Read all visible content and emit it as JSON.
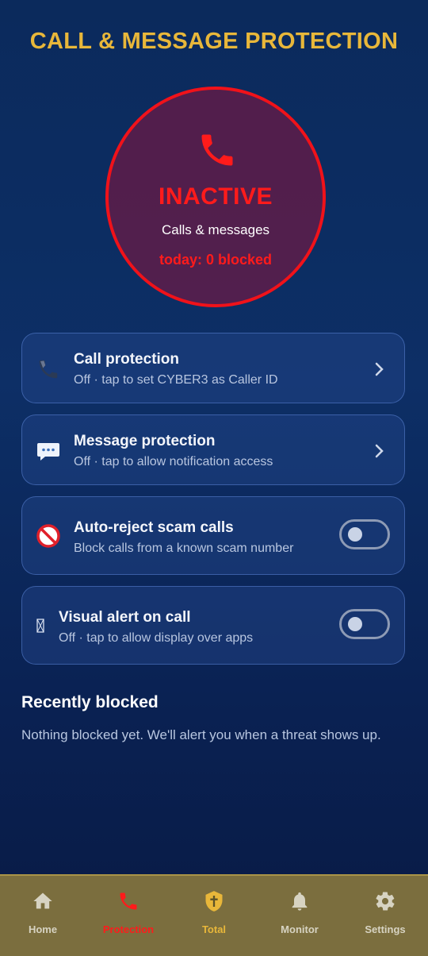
{
  "header": {
    "title": "CALL & MESSAGE PROTECTION"
  },
  "status": {
    "state": "INACTIVE",
    "subtitle": "Calls & messages",
    "today": "today: 0 blocked",
    "icon": "phone-icon",
    "color": "#ff1b1b"
  },
  "cards": [
    {
      "title": "Call protection",
      "subtitle": "Off · tap to set CYBER3 as Caller ID",
      "icon": "phone-icon",
      "control": "chevron"
    },
    {
      "title": "Message protection",
      "subtitle": "Off · tap to allow notification access",
      "icon": "message-icon",
      "control": "chevron"
    },
    {
      "title": "Auto-reject scam calls",
      "subtitle": "Block calls from a known scam number",
      "icon": "prohibited-icon",
      "control": "toggle",
      "enabled": false
    },
    {
      "title": "Visual alert on call",
      "subtitle": "Off · tap to allow display over apps",
      "icon": "missing-glyph-icon",
      "control": "toggle",
      "enabled": false
    }
  ],
  "recent": {
    "title": "Recently blocked",
    "empty": "Nothing blocked yet. We'll alert you when a threat shows up."
  },
  "nav": {
    "items": [
      {
        "label": "Home",
        "icon": "home-icon",
        "color": "#d7d3c2"
      },
      {
        "label": "Protection",
        "icon": "phone-icon",
        "color": "#ff1b1b",
        "active": true
      },
      {
        "label": "Total",
        "icon": "shield-cross-icon",
        "color": "#e8b73a"
      },
      {
        "label": "Monitor",
        "icon": "bell-icon",
        "color": "#d7d3c2"
      },
      {
        "label": "Settings",
        "icon": "gear-icon",
        "color": "#d7d3c2"
      }
    ]
  },
  "colors": {
    "accent": "#e8b73a",
    "danger": "#f0121a",
    "navbar": "#7b6e3e"
  }
}
